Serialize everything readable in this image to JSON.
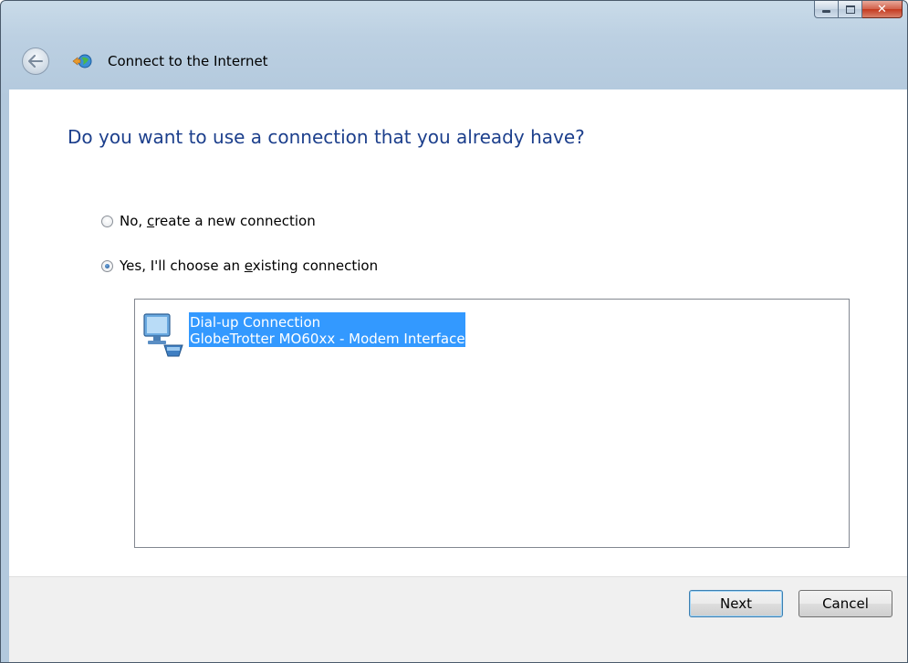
{
  "window": {
    "title": "Connect to the Internet",
    "caption_buttons": [
      "minimize",
      "maximize",
      "close"
    ]
  },
  "main": {
    "heading": "Do you want to use a connection that you already have?",
    "options": [
      {
        "label_pre": "No, ",
        "label_u": "c",
        "label_post": "reate a new connection",
        "selected": false
      },
      {
        "label_pre": "Yes, I'll choose an ",
        "label_u": "e",
        "label_post": "xisting connection",
        "selected": true
      }
    ],
    "connections": [
      {
        "name": "Dial-up Connection",
        "device": "GlobeTrotter MO60xx - Modem Interface",
        "selected": true,
        "icon": "dialup-connection-icon"
      }
    ]
  },
  "footer": {
    "next_label": "Next",
    "cancel_label": "Cancel"
  },
  "colors": {
    "heading": "#1c3f8c",
    "selection": "#3399ff",
    "frame": "#bcd0e2"
  }
}
